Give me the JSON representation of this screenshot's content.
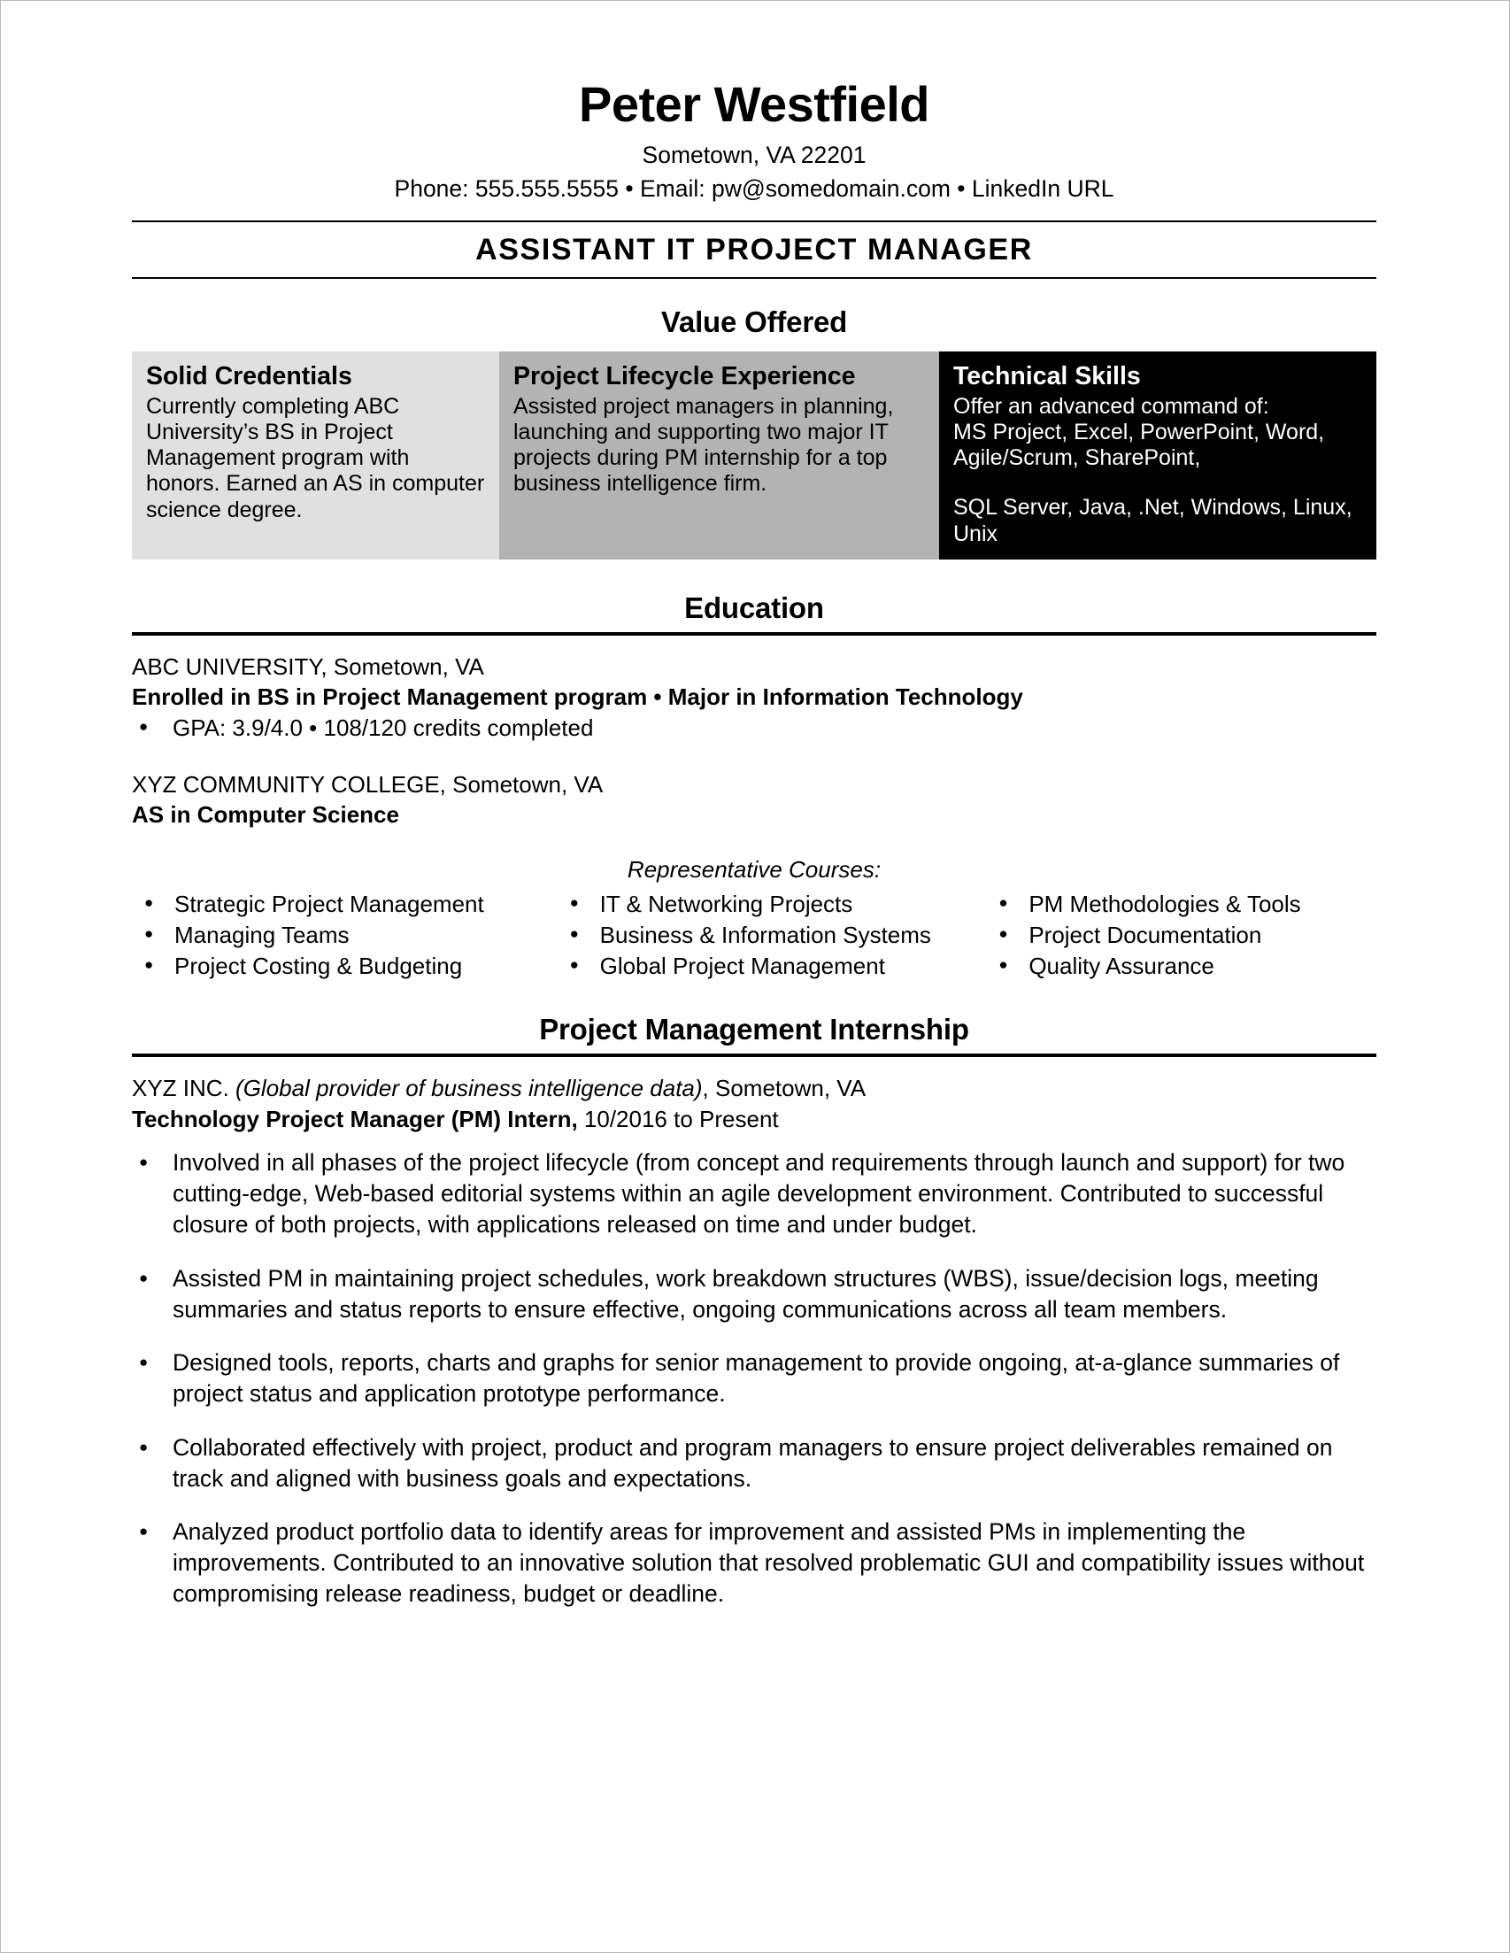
{
  "header": {
    "name": "Peter Westfield",
    "location": "Sometown, VA 22201",
    "contact": "Phone: 555.555.5555 • Email: pw@somedomain.com • LinkedIn URL",
    "target_title": "ASSISTANT IT PROJECT MANAGER"
  },
  "value_offered": {
    "heading": "Value Offered",
    "columns": [
      {
        "title": "Solid Credentials",
        "body": "Currently completing ABC University’s BS in Project Management program with honors. Earned an AS in computer science degree.",
        "bg": "#e0e0e0",
        "fg": "#000000"
      },
      {
        "title": "Project Lifecycle Experience",
        "body": "Assisted project managers in planning, launching and supporting two major IT projects during PM internship for a top business intelligence firm.",
        "bg": "#b3b3b3",
        "fg": "#000000"
      },
      {
        "title": "Technical Skills",
        "body_intro": "Offer an advanced command of:",
        "body_line1": "MS Project, Excel, PowerPoint, Word, Agile/Scrum, SharePoint,",
        "body_line2": "SQL Server, Java, .Net, Windows, Linux, Unix",
        "bg": "#000000",
        "fg": "#ffffff"
      }
    ]
  },
  "education": {
    "heading": "Education",
    "entries": [
      {
        "school": "ABC UNIVERSITY, Sometown, VA",
        "degree": "Enrolled in BS in Project Management program • Major in Information Technology",
        "bullets": [
          "GPA: 3.9/4.0 • 108/120 credits completed"
        ]
      },
      {
        "school": "XYZ COMMUNITY COLLEGE, Sometown, VA",
        "degree": "AS in Computer Science",
        "bullets": []
      }
    ],
    "courses_title": "Representative Courses:",
    "courses_columns": [
      [
        "Strategic Project Management",
        "Managing Teams",
        "Project Costing & Budgeting"
      ],
      [
        "IT & Networking Projects",
        "Business & Information Systems",
        "Global Project Management"
      ],
      [
        "PM Methodologies & Tools",
        "Project Documentation",
        "Quality Assurance"
      ]
    ]
  },
  "internship": {
    "heading": "Project Management Internship",
    "company": "XYZ INC.",
    "company_descriptor": "(Global provider of business intelligence data)",
    "company_location": ", Sometown, VA",
    "job_title": "Technology Project Manager (PM) Intern,",
    "job_dates": " 10/2016 to Present",
    "bullets": [
      "Involved in all phases of the project lifecycle (from concept and requirements through launch and support) for two cutting-edge, Web-based editorial systems within an agile development environment. Contributed to successful closure of both projects, with applications released on time and under budget.",
      "Assisted PM in maintaining project schedules, work breakdown structures (WBS), issue/decision logs, meeting summaries and status reports to ensure effective, ongoing communications across all team members.",
      "Designed tools, reports, charts and graphs for senior management to provide ongoing, at-a-glance summaries of project status and application prototype performance.",
      "Collaborated effectively with project, product and program managers to ensure project deliverables remained on track and aligned with business goals and expectations.",
      "Analyzed product portfolio data to identify areas for improvement and assisted PMs in implementing the improvements. Contributed to an innovative solution that resolved problematic GUI and compatibility issues without compromising release readiness, budget or deadline."
    ]
  }
}
